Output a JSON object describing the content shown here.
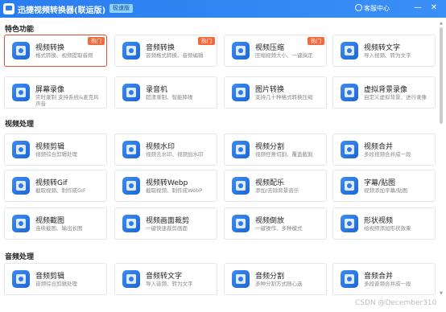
{
  "titlebar": {
    "title": "迅捷视频转换器(联运版)",
    "badge": "极速版",
    "support": "客服中心",
    "minimize": "—",
    "close": "✕"
  },
  "colors": {
    "titlebar": "#2a7df0",
    "accent": "#2d7be8",
    "hot": "#f06a3c",
    "highlight_border": "#e04b3a"
  },
  "sections": {
    "special": {
      "title": "特色功能",
      "cards": [
        {
          "title": "视频转换",
          "desc": "格式转换、视频提取音频",
          "hot": "热门",
          "icon": "video-convert-icon"
        },
        {
          "title": "音频转换",
          "desc": "音频格式转换、音频编辑",
          "hot": "热门",
          "icon": "audio-convert-icon"
        },
        {
          "title": "视频压缩",
          "desc": "压缩视频大小、一键搞定",
          "hot": "热门",
          "icon": "video-compress-icon"
        },
        {
          "title": "视频转文字",
          "desc": "导入视频、转为文字",
          "hot": "",
          "icon": "video-to-text-icon"
        },
        {
          "title": "屏幕录像",
          "desc": "实时录制 支持系统&麦克风声音",
          "hot": "",
          "icon": "screen-record-icon"
        },
        {
          "title": "录音机",
          "desc": "超清录制、智能降噪",
          "hot": "",
          "icon": "recorder-icon"
        },
        {
          "title": "图片转换",
          "desc": "支持几十种格式转换压缩",
          "hot": "",
          "icon": "image-convert-icon"
        },
        {
          "title": "虚拟背景录像",
          "desc": "自定义虚拟背景、进行录像",
          "hot": "",
          "icon": "virtual-bg-icon"
        }
      ]
    },
    "video": {
      "title": "视频处理",
      "cards": [
        {
          "title": "视频剪辑",
          "desc": "视频综合剪辑处理",
          "icon": "video-edit-icon"
        },
        {
          "title": "视频水印",
          "desc": "视频去水印、视频加水印",
          "icon": "watermark-icon"
        },
        {
          "title": "视频分割",
          "desc": "视频任意切割、覆盖截割",
          "icon": "video-split-icon"
        },
        {
          "title": "视频合并",
          "desc": "多段视频合并成一段",
          "icon": "video-merge-icon"
        },
        {
          "title": "视频转Gif",
          "desc": "截取视频、制作成GIF",
          "icon": "gif-icon"
        },
        {
          "title": "视频转Webp",
          "desc": "截取视频、制作成WebP",
          "icon": "webp-icon"
        },
        {
          "title": "视频配乐",
          "desc": "添加/去除背景音乐",
          "icon": "music-icon"
        },
        {
          "title": "字幕/贴图",
          "desc": "视频添加字幕/贴图",
          "icon": "subtitle-icon"
        },
        {
          "title": "视频截图",
          "desc": "连续截图、输出长图",
          "icon": "screenshot-icon"
        },
        {
          "title": "视频画面裁剪",
          "desc": "一键快速裁剪画面",
          "icon": "crop-icon"
        },
        {
          "title": "视频倒放",
          "desc": "一键操作、多种模式",
          "icon": "reverse-icon"
        },
        {
          "title": "形状视频",
          "desc": "给视频添加形状效果",
          "icon": "shape-icon"
        }
      ]
    },
    "audio": {
      "title": "音频处理",
      "cards": [
        {
          "title": "音频剪辑",
          "desc": "音频综合剪辑处理",
          "icon": "audio-edit-icon"
        },
        {
          "title": "音频转文字",
          "desc": "导入音频、转为文字",
          "icon": "audio-to-text-icon"
        },
        {
          "title": "音频分割",
          "desc": "多种分割方式随心选",
          "icon": "audio-split-icon"
        },
        {
          "title": "音频合并",
          "desc": "多段音频合并成一段",
          "icon": "audio-merge-icon"
        }
      ]
    }
  },
  "watermark": "CSDN @December310"
}
